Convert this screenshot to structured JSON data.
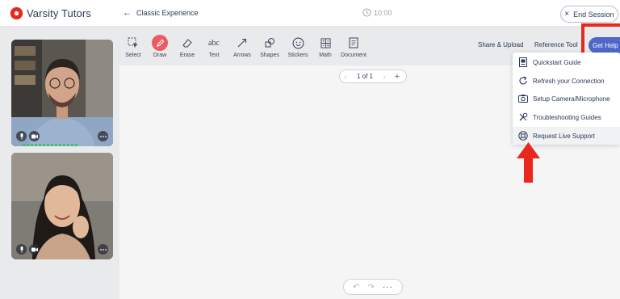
{
  "header": {
    "brand": "Varsity Tutors",
    "back_label": "Classic Experience",
    "timer": "10:00",
    "end_session": "End Session"
  },
  "toolbar": {
    "tools": [
      "Select",
      "Draw",
      "Erase",
      "Text",
      "Arrows",
      "Shapes",
      "Stickers",
      "Math",
      "Document"
    ],
    "share_upload": "Share & Upload",
    "reference_tools": "Reference Tools",
    "get_help": "Get Help"
  },
  "page_nav": {
    "label": "1 of 1"
  },
  "help_menu": {
    "items": [
      "Quickstart Guide",
      "Refresh your Connection",
      "Setup Camera/Microphone",
      "Troubleshooting Guides",
      "Request Live Support"
    ]
  },
  "colors": {
    "brand_red": "#e8271d",
    "draw_active": "#ec5a63",
    "get_help_bg": "#4f67c9",
    "accent_navy": "#2b3a55"
  },
  "icons": {
    "logo": "varsity-tutors-logo",
    "timer": "clock-icon",
    "end": "close-icon",
    "tools": [
      "select-icon",
      "pencil-icon",
      "eraser-icon",
      "text-abc-icon",
      "arrow-icon",
      "shapes-icon",
      "sticker-icon",
      "math-icon",
      "document-icon"
    ],
    "menu": [
      "book-icon",
      "refresh-icon",
      "camera-icon",
      "tools-icon",
      "support-icon"
    ]
  }
}
